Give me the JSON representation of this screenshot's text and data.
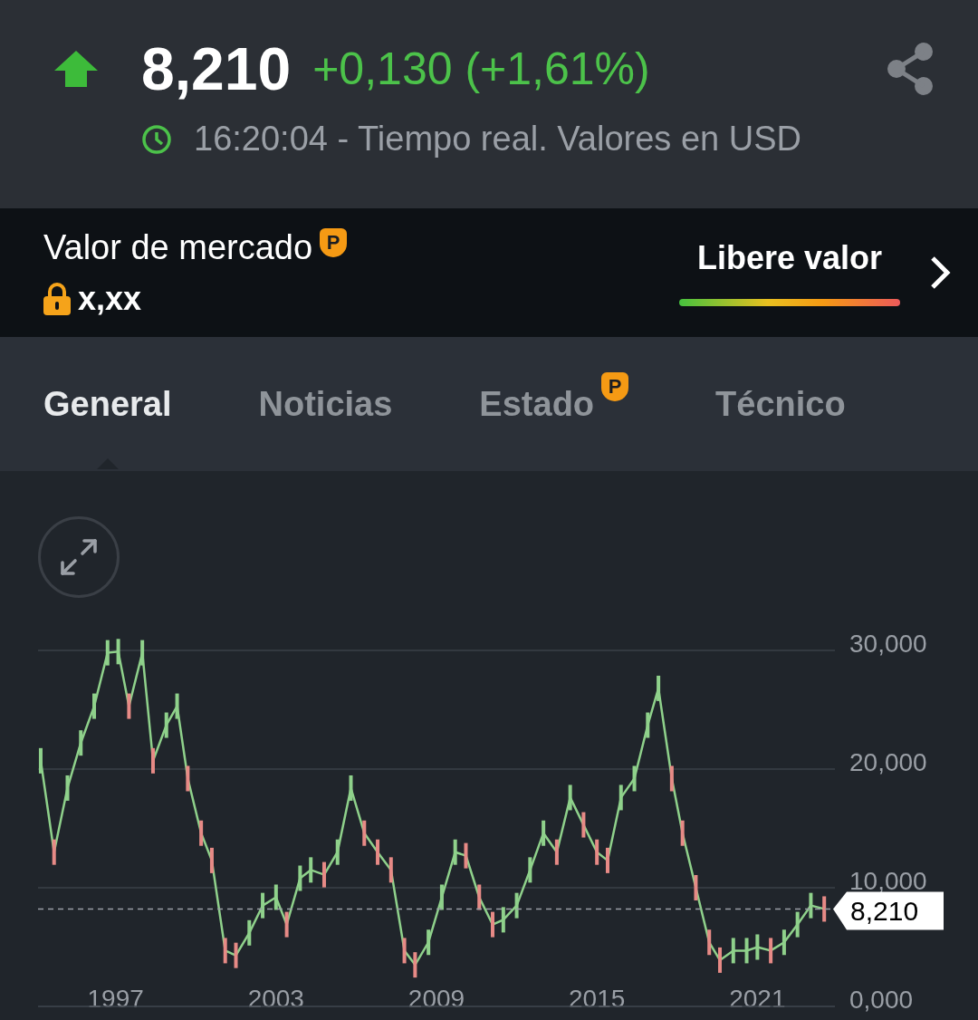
{
  "quote": {
    "up": true,
    "price": "8,210",
    "change": "+0,130 (+1,61%)",
    "time_note": "16:20:04 - Tiempo real. Valores en USD"
  },
  "market_value": {
    "label": "Valor de mercado",
    "badge": "P",
    "locked": true,
    "value": "x,xx",
    "cta": "Libere valor"
  },
  "tabs": [
    {
      "label": "General",
      "selected": true
    },
    {
      "label": "Noticias",
      "selected": false
    },
    {
      "label": "Estado",
      "selected": false,
      "badge": "P"
    },
    {
      "label": "Técnico",
      "selected": false
    }
  ],
  "chart": {
    "chart_data": {
      "type": "line",
      "x": [
        1994.2,
        1994.7,
        1995.2,
        1995.7,
        1996.2,
        1996.7,
        1997.1,
        1997.5,
        1998.0,
        1998.4,
        1998.9,
        1999.3,
        1999.7,
        2000.2,
        2000.6,
        2001.1,
        2001.5,
        2002.0,
        2002.5,
        2003.0,
        2003.4,
        2003.9,
        2004.3,
        2004.8,
        2005.3,
        2005.8,
        2006.3,
        2006.8,
        2007.3,
        2007.8,
        2008.2,
        2008.7,
        2009.2,
        2009.7,
        2010.1,
        2010.6,
        2011.1,
        2011.5,
        2012.0,
        2012.5,
        2013.0,
        2013.5,
        2014.0,
        2014.5,
        2015.0,
        2015.4,
        2015.9,
        2016.4,
        2016.9,
        2017.3,
        2017.8,
        2018.2,
        2018.7,
        2019.2,
        2019.6,
        2020.1,
        2020.6,
        2021.0,
        2021.5,
        2022.0,
        2022.5,
        2023.0,
        2023.5
      ],
      "series": [
        {
          "color": "#8fd18b",
          "values": [
            20.7,
            13.0,
            18.4,
            22.2,
            25.3,
            29.8,
            29.9,
            25.3,
            29.8,
            20.7,
            23.7,
            25.3,
            19.2,
            14.6,
            12.3,
            4.7,
            4.3,
            6.2,
            8.5,
            9.2,
            6.9,
            10.8,
            11.5,
            11.1,
            13.0,
            18.4,
            14.6,
            13.0,
            11.5,
            4.7,
            3.5,
            5.4,
            9.2,
            13.0,
            12.7,
            9.2,
            6.9,
            7.3,
            8.5,
            11.5,
            14.6,
            13.0,
            17.6,
            15.3,
            13.0,
            12.3,
            17.6,
            19.2,
            23.7,
            26.8,
            19.2,
            14.6,
            10.0,
            5.4,
            3.9,
            4.7,
            4.7,
            5.0,
            4.7,
            5.4,
            6.9,
            8.5,
            8.21
          ]
        }
      ],
      "xlim": [
        1994.1,
        2023.9
      ],
      "grid": true,
      "ref_lines": [
        {
          "axis": "y",
          "value": 8.21,
          "label": "8,210"
        }
      ],
      "ylim": [
        0,
        30
      ],
      "xticks": [
        1997,
        2003,
        2009,
        2015,
        2021
      ],
      "yticks": [
        {
          "value": 0,
          "label": "0,000"
        },
        {
          "value": 10,
          "label": "10,000"
        },
        {
          "value": 20,
          "label": "20,000"
        },
        {
          "value": 30,
          "label": "30,000"
        }
      ]
    }
  }
}
